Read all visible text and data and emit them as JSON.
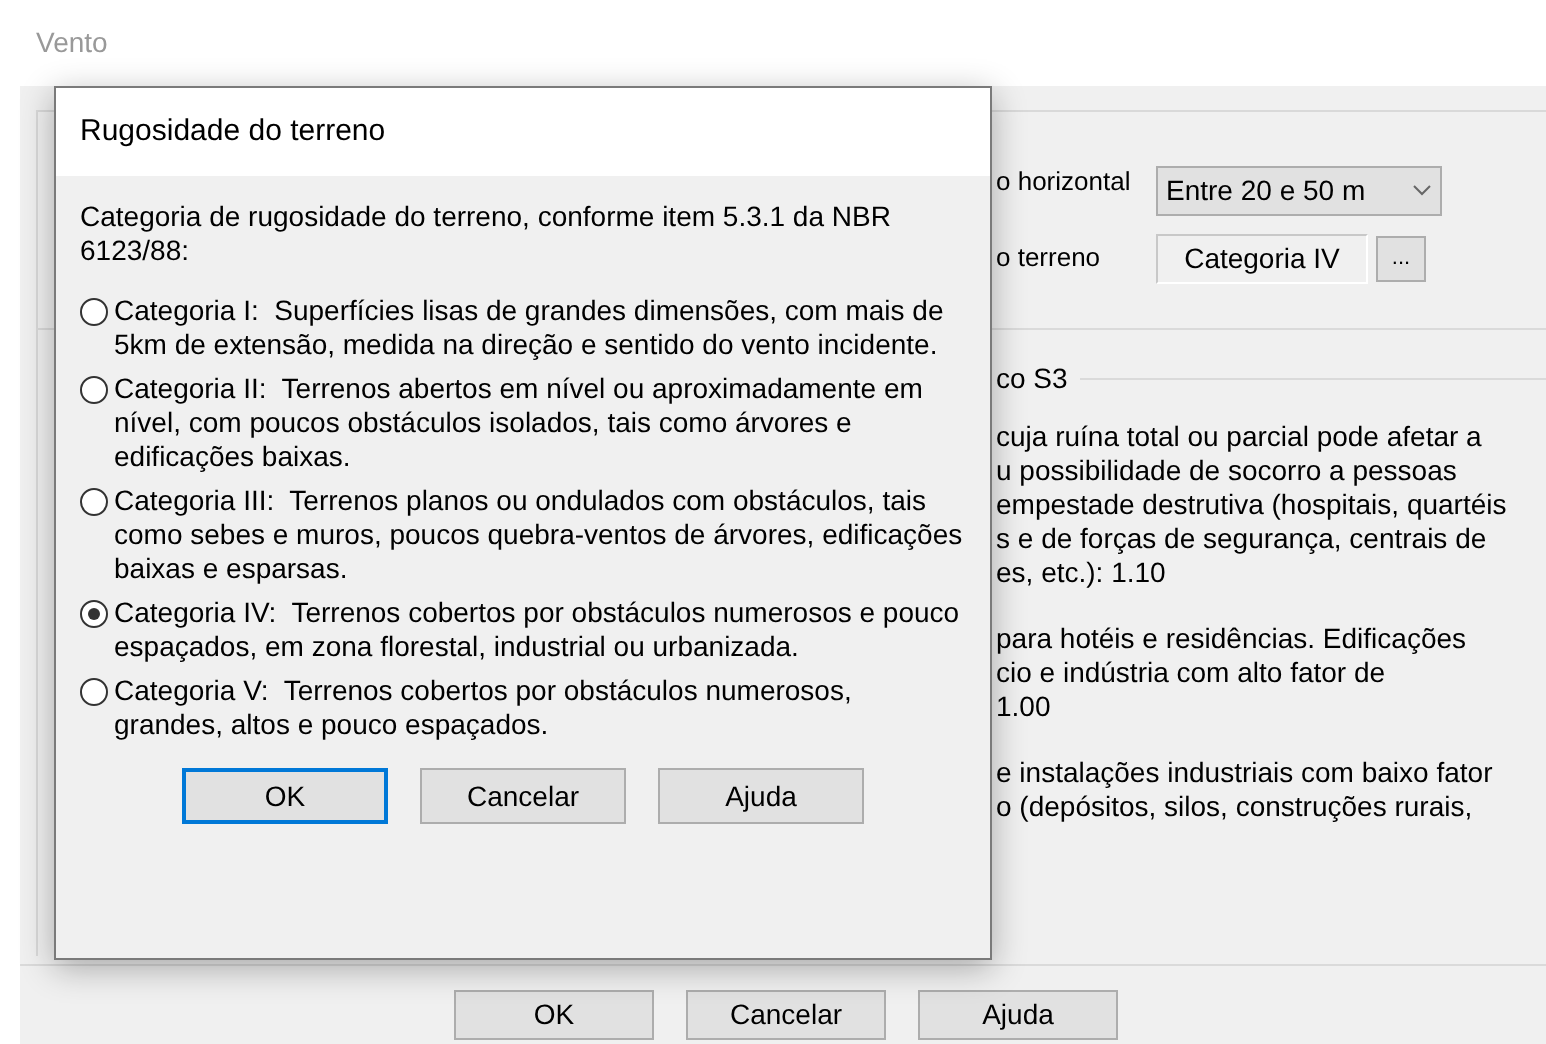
{
  "window": {
    "title": "Vento"
  },
  "background": {
    "fields": [
      {
        "kind": "dropdown",
        "label": "o horizontal",
        "value": "Entre 20 e 50 m"
      },
      {
        "kind": "browse",
        "label": "o terreno",
        "value": "Categoria IV",
        "button": "..."
      }
    ],
    "group_title": "co S3",
    "paragraphs": [
      [
        "cuja ruína total ou parcial pode afetar a",
        "u possibilidade de socorro a pessoas",
        "empestade destrutiva (hospitais, quartéis",
        "s e de forças de segurança, centrais de",
        "es, etc.): 1.10"
      ],
      [
        "para hotéis e residências. Edificações",
        "cio e indústria com alto fator de",
        "1.00"
      ],
      [
        "e instalações industriais com baixo fator",
        "o (depósitos, silos, construções rurais,"
      ]
    ],
    "buttons": [
      "OK",
      "Cancelar",
      "Ajuda"
    ]
  },
  "dialog": {
    "title": "Rugosidade do terreno",
    "intro": "Categoria de rugosidade do terreno, conforme item 5.3.1 da NBR 6123/88:",
    "options": [
      {
        "text": "Categoria I:  Superfícies lisas de grandes dimensões, com mais de 5km de extensão, medida na direção e sentido do vento incidente.",
        "selected": false
      },
      {
        "text": "Categoria II:  Terrenos abertos em nível ou aproximadamente em nível, com poucos obstáculos isolados, tais como árvores e edificações baixas.",
        "selected": false
      },
      {
        "text": "Categoria III:  Terrenos planos ou ondulados com obstáculos, tais como sebes e muros, poucos quebra-ventos de árvores, edificações baixas e esparsas.",
        "selected": false
      },
      {
        "text": "Categoria IV:  Terrenos cobertos por obstáculos numerosos e pouco espaçados, em zona florestal, industrial ou urbanizada.",
        "selected": true
      },
      {
        "text": "Categoria V:  Terrenos cobertos por obstáculos numerosos, grandes, altos e pouco espaçados.",
        "selected": false
      }
    ],
    "buttons": [
      {
        "label": "OK",
        "default": true
      },
      {
        "label": "Cancelar",
        "default": false
      },
      {
        "label": "Ajuda",
        "default": false
      }
    ]
  }
}
